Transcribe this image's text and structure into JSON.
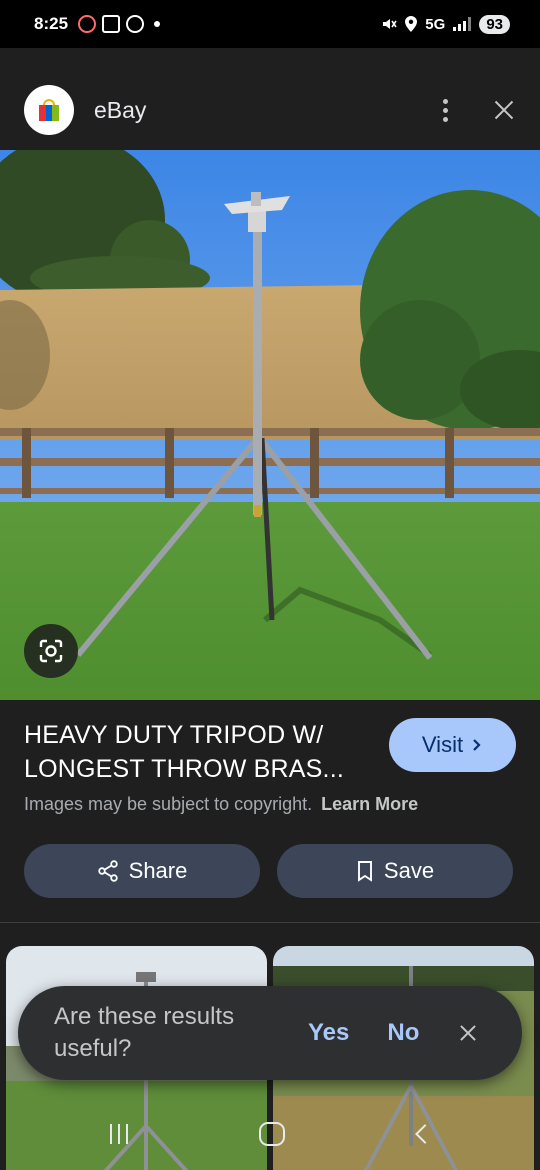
{
  "status_bar": {
    "time": "8:25",
    "network": "5G",
    "battery": "93"
  },
  "header": {
    "site_name": "eBay",
    "logo_icon": "ebay-bag-icon"
  },
  "result": {
    "title": "HEAVY DUTY TRIPOD W/ LONGEST THROW BRAS...",
    "visit_label": "Visit",
    "copyright_text": "Images may be subject to copyright.",
    "learn_more_label": "Learn More",
    "share_label": "Share",
    "save_label": "Save"
  },
  "feedback": {
    "question": "Are these results useful?",
    "yes_label": "Yes",
    "no_label": "No"
  },
  "colors": {
    "background": "#1f1f1f",
    "accent": "#a8c7fa",
    "button_bg": "#3c4658"
  }
}
